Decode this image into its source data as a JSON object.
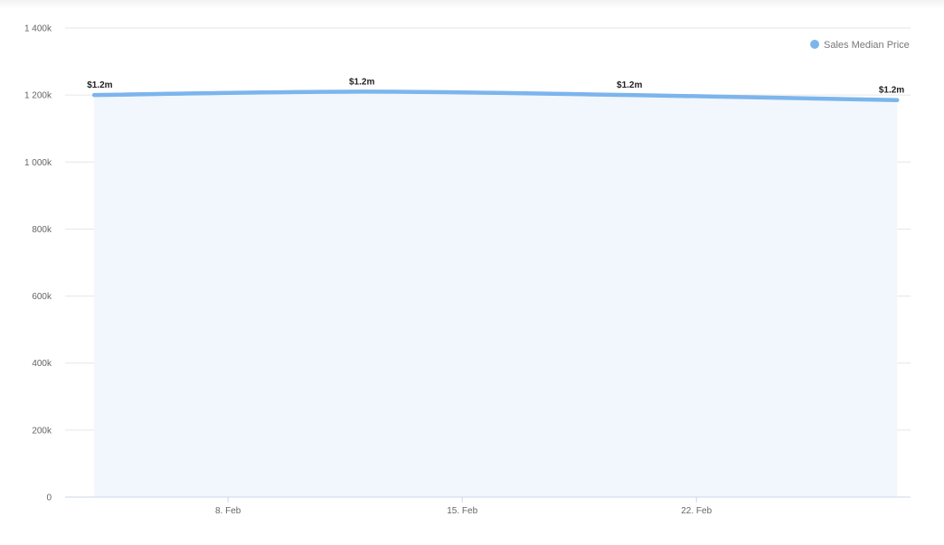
{
  "chart_data": {
    "type": "area",
    "x": [
      "2024-02-04",
      "2024-02-12",
      "2024-02-20",
      "2024-02-28"
    ],
    "x_ticks": [
      "8. Feb",
      "15. Feb",
      "22. Feb"
    ],
    "y_ticks": [
      "0",
      "200k",
      "400k",
      "600k",
      "800k",
      "1 000k",
      "1 200k",
      "1 400k"
    ],
    "ylim": [
      0,
      1400000
    ],
    "grid": true,
    "legend_position": "top-right",
    "series": [
      {
        "name": "Sales Median Price",
        "color": "#7cb5ec",
        "values": [
          1200000,
          1210000,
          1200000,
          1185000
        ],
        "data_labels": [
          "$1.2m",
          "$1.2m",
          "$1.2m",
          "$1.2m"
        ]
      }
    ]
  }
}
